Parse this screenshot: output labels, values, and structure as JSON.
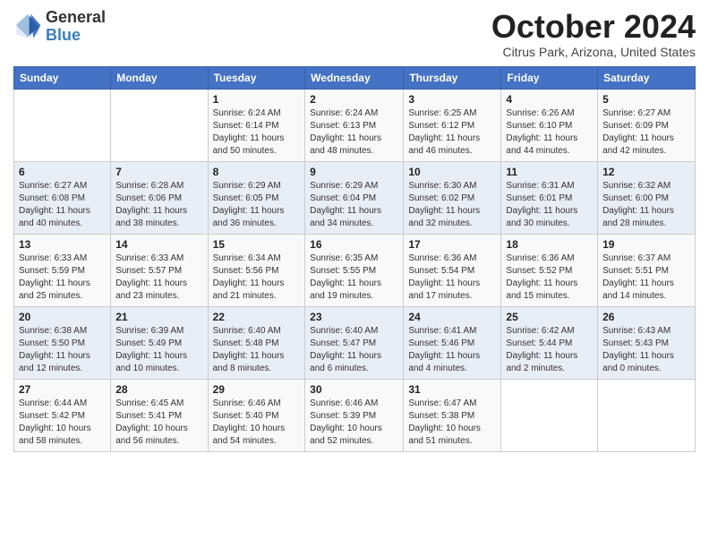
{
  "logo": {
    "general": "General",
    "blue": "Blue"
  },
  "header": {
    "month": "October 2024",
    "location": "Citrus Park, Arizona, United States"
  },
  "days_of_week": [
    "Sunday",
    "Monday",
    "Tuesday",
    "Wednesday",
    "Thursday",
    "Friday",
    "Saturday"
  ],
  "weeks": [
    [
      {
        "day": "",
        "info": ""
      },
      {
        "day": "",
        "info": ""
      },
      {
        "day": "1",
        "info": "Sunrise: 6:24 AM\nSunset: 6:14 PM\nDaylight: 11 hours and 50 minutes."
      },
      {
        "day": "2",
        "info": "Sunrise: 6:24 AM\nSunset: 6:13 PM\nDaylight: 11 hours and 48 minutes."
      },
      {
        "day": "3",
        "info": "Sunrise: 6:25 AM\nSunset: 6:12 PM\nDaylight: 11 hours and 46 minutes."
      },
      {
        "day": "4",
        "info": "Sunrise: 6:26 AM\nSunset: 6:10 PM\nDaylight: 11 hours and 44 minutes."
      },
      {
        "day": "5",
        "info": "Sunrise: 6:27 AM\nSunset: 6:09 PM\nDaylight: 11 hours and 42 minutes."
      }
    ],
    [
      {
        "day": "6",
        "info": "Sunrise: 6:27 AM\nSunset: 6:08 PM\nDaylight: 11 hours and 40 minutes."
      },
      {
        "day": "7",
        "info": "Sunrise: 6:28 AM\nSunset: 6:06 PM\nDaylight: 11 hours and 38 minutes."
      },
      {
        "day": "8",
        "info": "Sunrise: 6:29 AM\nSunset: 6:05 PM\nDaylight: 11 hours and 36 minutes."
      },
      {
        "day": "9",
        "info": "Sunrise: 6:29 AM\nSunset: 6:04 PM\nDaylight: 11 hours and 34 minutes."
      },
      {
        "day": "10",
        "info": "Sunrise: 6:30 AM\nSunset: 6:02 PM\nDaylight: 11 hours and 32 minutes."
      },
      {
        "day": "11",
        "info": "Sunrise: 6:31 AM\nSunset: 6:01 PM\nDaylight: 11 hours and 30 minutes."
      },
      {
        "day": "12",
        "info": "Sunrise: 6:32 AM\nSunset: 6:00 PM\nDaylight: 11 hours and 28 minutes."
      }
    ],
    [
      {
        "day": "13",
        "info": "Sunrise: 6:33 AM\nSunset: 5:59 PM\nDaylight: 11 hours and 25 minutes."
      },
      {
        "day": "14",
        "info": "Sunrise: 6:33 AM\nSunset: 5:57 PM\nDaylight: 11 hours and 23 minutes."
      },
      {
        "day": "15",
        "info": "Sunrise: 6:34 AM\nSunset: 5:56 PM\nDaylight: 11 hours and 21 minutes."
      },
      {
        "day": "16",
        "info": "Sunrise: 6:35 AM\nSunset: 5:55 PM\nDaylight: 11 hours and 19 minutes."
      },
      {
        "day": "17",
        "info": "Sunrise: 6:36 AM\nSunset: 5:54 PM\nDaylight: 11 hours and 17 minutes."
      },
      {
        "day": "18",
        "info": "Sunrise: 6:36 AM\nSunset: 5:52 PM\nDaylight: 11 hours and 15 minutes."
      },
      {
        "day": "19",
        "info": "Sunrise: 6:37 AM\nSunset: 5:51 PM\nDaylight: 11 hours and 14 minutes."
      }
    ],
    [
      {
        "day": "20",
        "info": "Sunrise: 6:38 AM\nSunset: 5:50 PM\nDaylight: 11 hours and 12 minutes."
      },
      {
        "day": "21",
        "info": "Sunrise: 6:39 AM\nSunset: 5:49 PM\nDaylight: 11 hours and 10 minutes."
      },
      {
        "day": "22",
        "info": "Sunrise: 6:40 AM\nSunset: 5:48 PM\nDaylight: 11 hours and 8 minutes."
      },
      {
        "day": "23",
        "info": "Sunrise: 6:40 AM\nSunset: 5:47 PM\nDaylight: 11 hours and 6 minutes."
      },
      {
        "day": "24",
        "info": "Sunrise: 6:41 AM\nSunset: 5:46 PM\nDaylight: 11 hours and 4 minutes."
      },
      {
        "day": "25",
        "info": "Sunrise: 6:42 AM\nSunset: 5:44 PM\nDaylight: 11 hours and 2 minutes."
      },
      {
        "day": "26",
        "info": "Sunrise: 6:43 AM\nSunset: 5:43 PM\nDaylight: 11 hours and 0 minutes."
      }
    ],
    [
      {
        "day": "27",
        "info": "Sunrise: 6:44 AM\nSunset: 5:42 PM\nDaylight: 10 hours and 58 minutes."
      },
      {
        "day": "28",
        "info": "Sunrise: 6:45 AM\nSunset: 5:41 PM\nDaylight: 10 hours and 56 minutes."
      },
      {
        "day": "29",
        "info": "Sunrise: 6:46 AM\nSunset: 5:40 PM\nDaylight: 10 hours and 54 minutes."
      },
      {
        "day": "30",
        "info": "Sunrise: 6:46 AM\nSunset: 5:39 PM\nDaylight: 10 hours and 52 minutes."
      },
      {
        "day": "31",
        "info": "Sunrise: 6:47 AM\nSunset: 5:38 PM\nDaylight: 10 hours and 51 minutes."
      },
      {
        "day": "",
        "info": ""
      },
      {
        "day": "",
        "info": ""
      }
    ]
  ]
}
